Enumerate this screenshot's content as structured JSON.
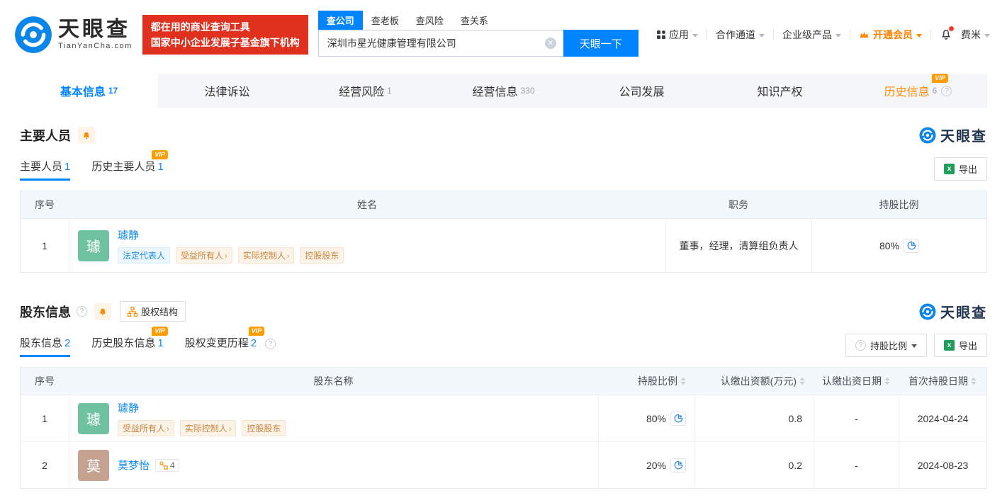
{
  "header": {
    "logo": {
      "brand": "天眼查",
      "domain": "TianYanCha.com"
    },
    "banner": {
      "line1": "都在用的商业查询工具",
      "line2": "国家中小企业发展子基金旗下机构"
    },
    "search": {
      "tabs": [
        {
          "label": "查公司"
        },
        {
          "label": "查老板"
        },
        {
          "label": "查风险"
        },
        {
          "label": "查关系"
        }
      ],
      "input_value": "深圳市星光健康管理有限公司",
      "button_label": "天眼一下"
    },
    "nav": {
      "apps": "应用",
      "partner": "合作通道",
      "enterprise": "企业级产品",
      "vip": "开通会员",
      "user": "费米"
    }
  },
  "main_tabs": [
    {
      "label": "基本信息",
      "count": "17"
    },
    {
      "label": "法律诉讼",
      "count": ""
    },
    {
      "label": "经营风险",
      "count": "1"
    },
    {
      "label": "经营信息",
      "count": "330"
    },
    {
      "label": "公司发展",
      "count": ""
    },
    {
      "label": "知识产权",
      "count": ""
    },
    {
      "label": "历史信息",
      "count": "6",
      "vip": "VIP"
    }
  ],
  "staff_section": {
    "title": "主要人员",
    "watermark": "天眼查",
    "subtabs": [
      {
        "label": "主要人员",
        "count": "1"
      },
      {
        "label": "历史主要人员",
        "count": "1",
        "vip": "VIP"
      }
    ],
    "export_label": "导出",
    "table": {
      "headers": {
        "index": "序号",
        "name": "姓名",
        "position": "职务",
        "ratio": "持股比例"
      },
      "row": {
        "index": "1",
        "avatar_char": "璩",
        "avatar_color": "#6fc2a0",
        "name": "璩静",
        "tags": [
          {
            "label": "法定代表人"
          },
          {
            "label": "受益所有人"
          },
          {
            "label": "实际控制人"
          },
          {
            "label": "控股股东"
          }
        ],
        "position": "董事，经理，清算组负责人",
        "ratio": "80%"
      }
    }
  },
  "shareholder_section": {
    "title": "股东信息",
    "structure_button": "股权结构",
    "watermark": "天眼查",
    "subtabs": [
      {
        "label": "股东信息",
        "count": "2"
      },
      {
        "label": "历史股东信息",
        "count": "1",
        "vip": "VIP"
      },
      {
        "label": "股权变更历程",
        "count": "2",
        "vip": "VIP"
      }
    ],
    "filter_button": "持股比例",
    "export_label": "导出",
    "table": {
      "headers": {
        "index": "序号",
        "name": "股东名称",
        "ratio": "持股比例",
        "amount": "认缴出资额(万元)",
        "date": "认缴出资日期",
        "first_date": "首次持股日期"
      },
      "rows": [
        {
          "index": "1",
          "avatar_char": "璩",
          "avatar_color": "#6fc2a0",
          "name": "璩静",
          "tags": [
            {
              "label": "受益所有人"
            },
            {
              "label": "实际控制人"
            },
            {
              "label": "控股股东"
            }
          ],
          "ratio": "80%",
          "amount": "0.8",
          "date": "-",
          "first_date": "2024-04-24"
        },
        {
          "index": "2",
          "avatar_char": "莫",
          "avatar_color": "#c5a18f",
          "name": "莫梦怡",
          "relation_count": "4",
          "ratio": "20%",
          "amount": "0.2",
          "date": "-",
          "first_date": "2024-08-23"
        }
      ]
    }
  },
  "colors": {
    "brand_blue": "#0084ff",
    "link_blue": "#128bed",
    "accent_orange": "#ff8a00",
    "banner_red": "#e0301e",
    "avatar_green": "#6fc2a0",
    "avatar_tan": "#c5a18f"
  }
}
